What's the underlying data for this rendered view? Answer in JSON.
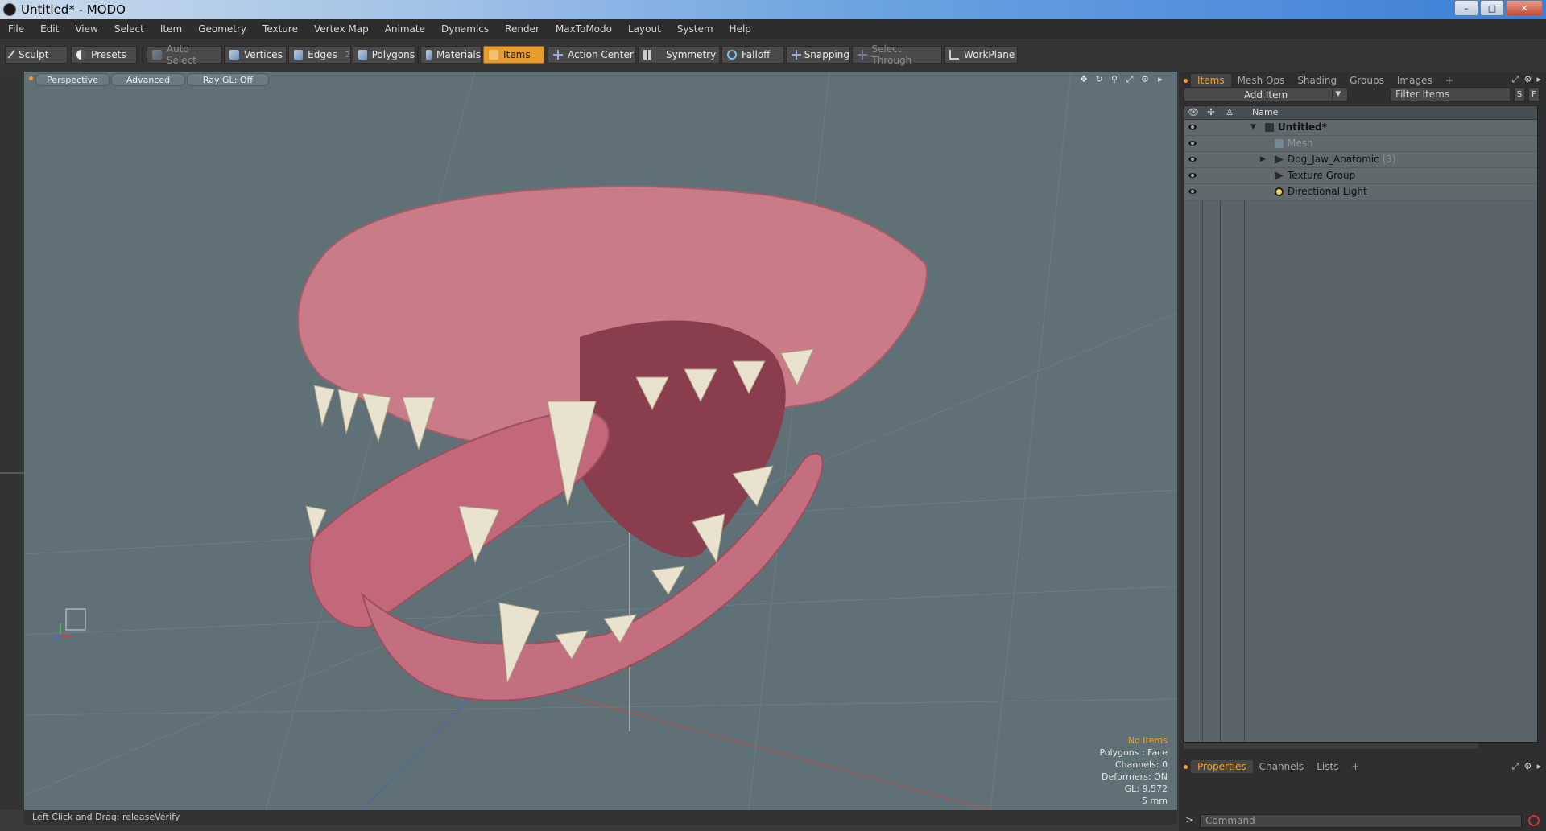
{
  "window": {
    "title": "Untitled* - MODO",
    "controls": [
      "–",
      "□",
      "✕"
    ]
  },
  "menu": [
    "File",
    "Edit",
    "View",
    "Select",
    "Item",
    "Geometry",
    "Texture",
    "Vertex Map",
    "Animate",
    "Dynamics",
    "Render",
    "MaxToModo",
    "Layout",
    "System",
    "Help"
  ],
  "toolbar": {
    "sculpt": "Sculpt",
    "presets": "Presets",
    "auto_select": "Auto Select",
    "vertices": "Vertices",
    "edges": "Edges",
    "edges_count": "2",
    "polygons": "Polygons",
    "materials": "Materials",
    "items": "Items",
    "action_center": "Action Center",
    "symmetry": "Symmetry",
    "falloff": "Falloff",
    "snapping": "Snapping",
    "select_through": "Select Through",
    "workplane": "WorkPlane"
  },
  "viewport": {
    "tabs": [
      "Perspective",
      "Advanced",
      "Ray GL: Off"
    ],
    "info": {
      "selection": "No Items",
      "polygons": "Polygons : Face",
      "channels": "Channels: 0",
      "deformers": "Deformers: ON",
      "gl": "GL: 9,572",
      "scale": "5 mm"
    }
  },
  "status": "Left Click and Drag:  releaseVerify",
  "items_panel": {
    "tabs": [
      "Items",
      "Mesh Ops",
      "Shading",
      "Groups",
      "Images",
      "+"
    ],
    "add_item": "Add Item",
    "filter_placeholder": "Filter Items",
    "s_btn": "S",
    "f_btn": "F",
    "name_header": "Name",
    "rows": [
      {
        "label": "Untitled*",
        "count": ""
      },
      {
        "label": "Mesh",
        "count": ""
      },
      {
        "label": "Dog_Jaw_Anatomic",
        "count": "(3)"
      },
      {
        "label": "Texture Group",
        "count": ""
      },
      {
        "label": "Directional Light",
        "count": ""
      }
    ]
  },
  "properties_panel": {
    "tabs": [
      "Properties",
      "Channels",
      "Lists",
      "+"
    ]
  },
  "command": {
    "prompt": ">",
    "placeholder": "Command"
  }
}
